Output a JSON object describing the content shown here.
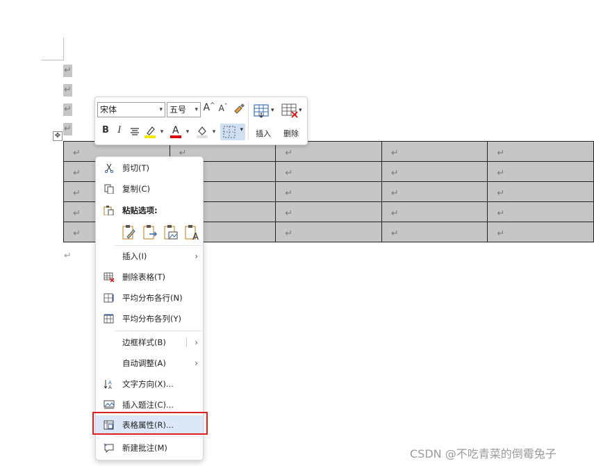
{
  "paragraph_mark": "↵",
  "table": {
    "rows": 5,
    "cols": 5
  },
  "mini_toolbar": {
    "font_name": "宋体",
    "font_size": "五号",
    "insert_label": "插入",
    "delete_label": "删除",
    "colors": {
      "highlight": "#f5e800",
      "font_color": "#e00000"
    }
  },
  "context_menu": {
    "cut": "剪切(T)",
    "copy": "复制(C)",
    "paste_options": "粘贴选项:",
    "insert": "插入(I)",
    "delete_table": "删除表格(T)",
    "distribute_rows": "平均分布各行(N)",
    "distribute_cols": "平均分布各列(Y)",
    "border_styles": "边框样式(B)",
    "autofit": "自动调整(A)",
    "text_direction": "文字方向(X)...",
    "insert_caption": "插入题注(C)...",
    "table_properties": "表格属性(R)...",
    "new_comment": "新建批注(M)"
  },
  "highlight_color": "#e02020",
  "watermark": "CSDN @不吃青菜的倒霉兔子"
}
